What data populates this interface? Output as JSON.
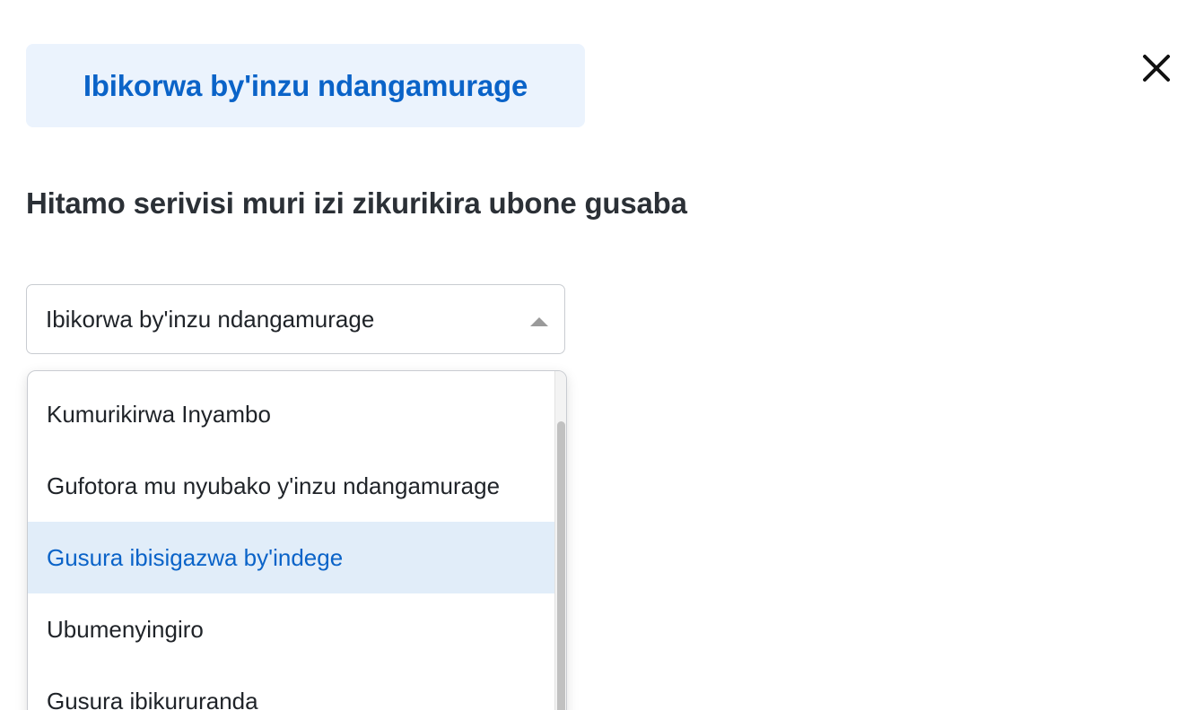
{
  "header": {
    "title": "Ibikorwa by'inzu ndangamurage",
    "close_icon": "close-icon"
  },
  "prompt": "Hitamo serivisi muri izi zikurikira ubone gusaba",
  "select": {
    "value": "Ibikorwa by'inzu ndangamurage",
    "expanded": true,
    "caret_icon": "chevron-up-icon"
  },
  "options": [
    {
      "label": "Kumurikirwa Inyambo",
      "active": false
    },
    {
      "label": "Gufotora mu nyubako y'inzu ndangamurage",
      "active": false
    },
    {
      "label": "Gusura ibisigazwa by'indege",
      "active": true
    },
    {
      "label": "Ubumenyingiro",
      "active": false
    },
    {
      "label": "Gusura ibikururanda",
      "active": false
    }
  ],
  "colors": {
    "accent": "#0a63c8",
    "chip_bg": "#ebf3fd",
    "active_option_bg": "#e1edf9",
    "text": "#2b3036"
  }
}
